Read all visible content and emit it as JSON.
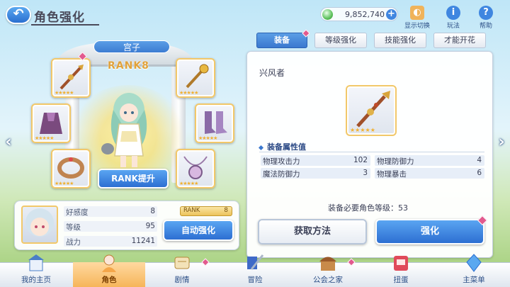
{
  "header": {
    "back_icon": "back-arrow-icon",
    "title": "角色强化",
    "currency": {
      "icon": "jewel-icon",
      "value": "9,852,740",
      "plus_icon": "plus-icon"
    },
    "display_switch": {
      "icon": "display-switch-icon",
      "label": "显示切换"
    },
    "guide": {
      "icon": "info-icon",
      "label": "玩法"
    },
    "help": {
      "icon": "help-icon",
      "label": "帮助"
    }
  },
  "character": {
    "name": "宫子",
    "rank_label": "RANK8",
    "rank_up_button": "RANK提升",
    "equipment_slots": [
      {
        "name": "spear-icon",
        "stars": "★★★★★",
        "notify": true
      },
      {
        "name": "scepter-icon",
        "stars": "★★★★★",
        "notify": false
      },
      {
        "name": "robe-icon",
        "stars": "★★★★★",
        "notify": false
      },
      {
        "name": "boots-icon",
        "stars": "★★★★★",
        "notify": false
      },
      {
        "name": "bracelet-icon",
        "stars": "★★★★★",
        "notify": false
      },
      {
        "name": "pendant-icon",
        "stars": "★★★★★",
        "notify": false
      }
    ]
  },
  "stats": {
    "rows": [
      {
        "label": "好感度",
        "value": "8"
      },
      {
        "label": "等级",
        "value": "95"
      },
      {
        "label": "战力",
        "value": "11241"
      }
    ],
    "rank_label": "RANK",
    "rank_value": "8",
    "auto_enhance_button": "自动强化"
  },
  "tabs": [
    {
      "label": "装备",
      "active": true,
      "notify": true
    },
    {
      "label": "等级强化",
      "active": false,
      "notify": false
    },
    {
      "label": "技能强化",
      "active": false,
      "notify": false
    },
    {
      "label": "才能开花",
      "active": false,
      "notify": false
    }
  ],
  "detail": {
    "equip_name": "兴风者",
    "equip_stars": "★★★★★",
    "section_title": "装备属性值",
    "attributes": [
      {
        "label": "物理攻击力",
        "value": "102"
      },
      {
        "label": "物理防御力",
        "value": "4"
      },
      {
        "label": "魔法防御力",
        "value": "3"
      },
      {
        "label": "物理暴击",
        "value": "6"
      }
    ],
    "required_level_text": "装备必要角色等级：53",
    "obtain_button": "获取方法",
    "enhance_button": "强化"
  },
  "nav": [
    {
      "label": "我的主页",
      "icon": "home-castle-icon",
      "active": false,
      "notify": false
    },
    {
      "label": "角色",
      "icon": "character-icon",
      "active": true,
      "notify": false
    },
    {
      "label": "剧情",
      "icon": "story-scroll-icon",
      "active": false,
      "notify": true
    },
    {
      "label": "冒险",
      "icon": "adventure-sword-icon",
      "active": false,
      "notify": false
    },
    {
      "label": "公会之家",
      "icon": "guild-house-icon",
      "active": false,
      "notify": true
    },
    {
      "label": "扭蛋",
      "icon": "gacha-icon",
      "active": false,
      "notify": false
    },
    {
      "label": "主菜单",
      "icon": "main-menu-crystal-icon",
      "active": false,
      "notify": false
    }
  ],
  "colors": {
    "accent_blue": "#3a78cf",
    "gold_frame": "#f2c86a",
    "notify_pink": "#e25a8e",
    "nav_active": "#f6b55a"
  }
}
